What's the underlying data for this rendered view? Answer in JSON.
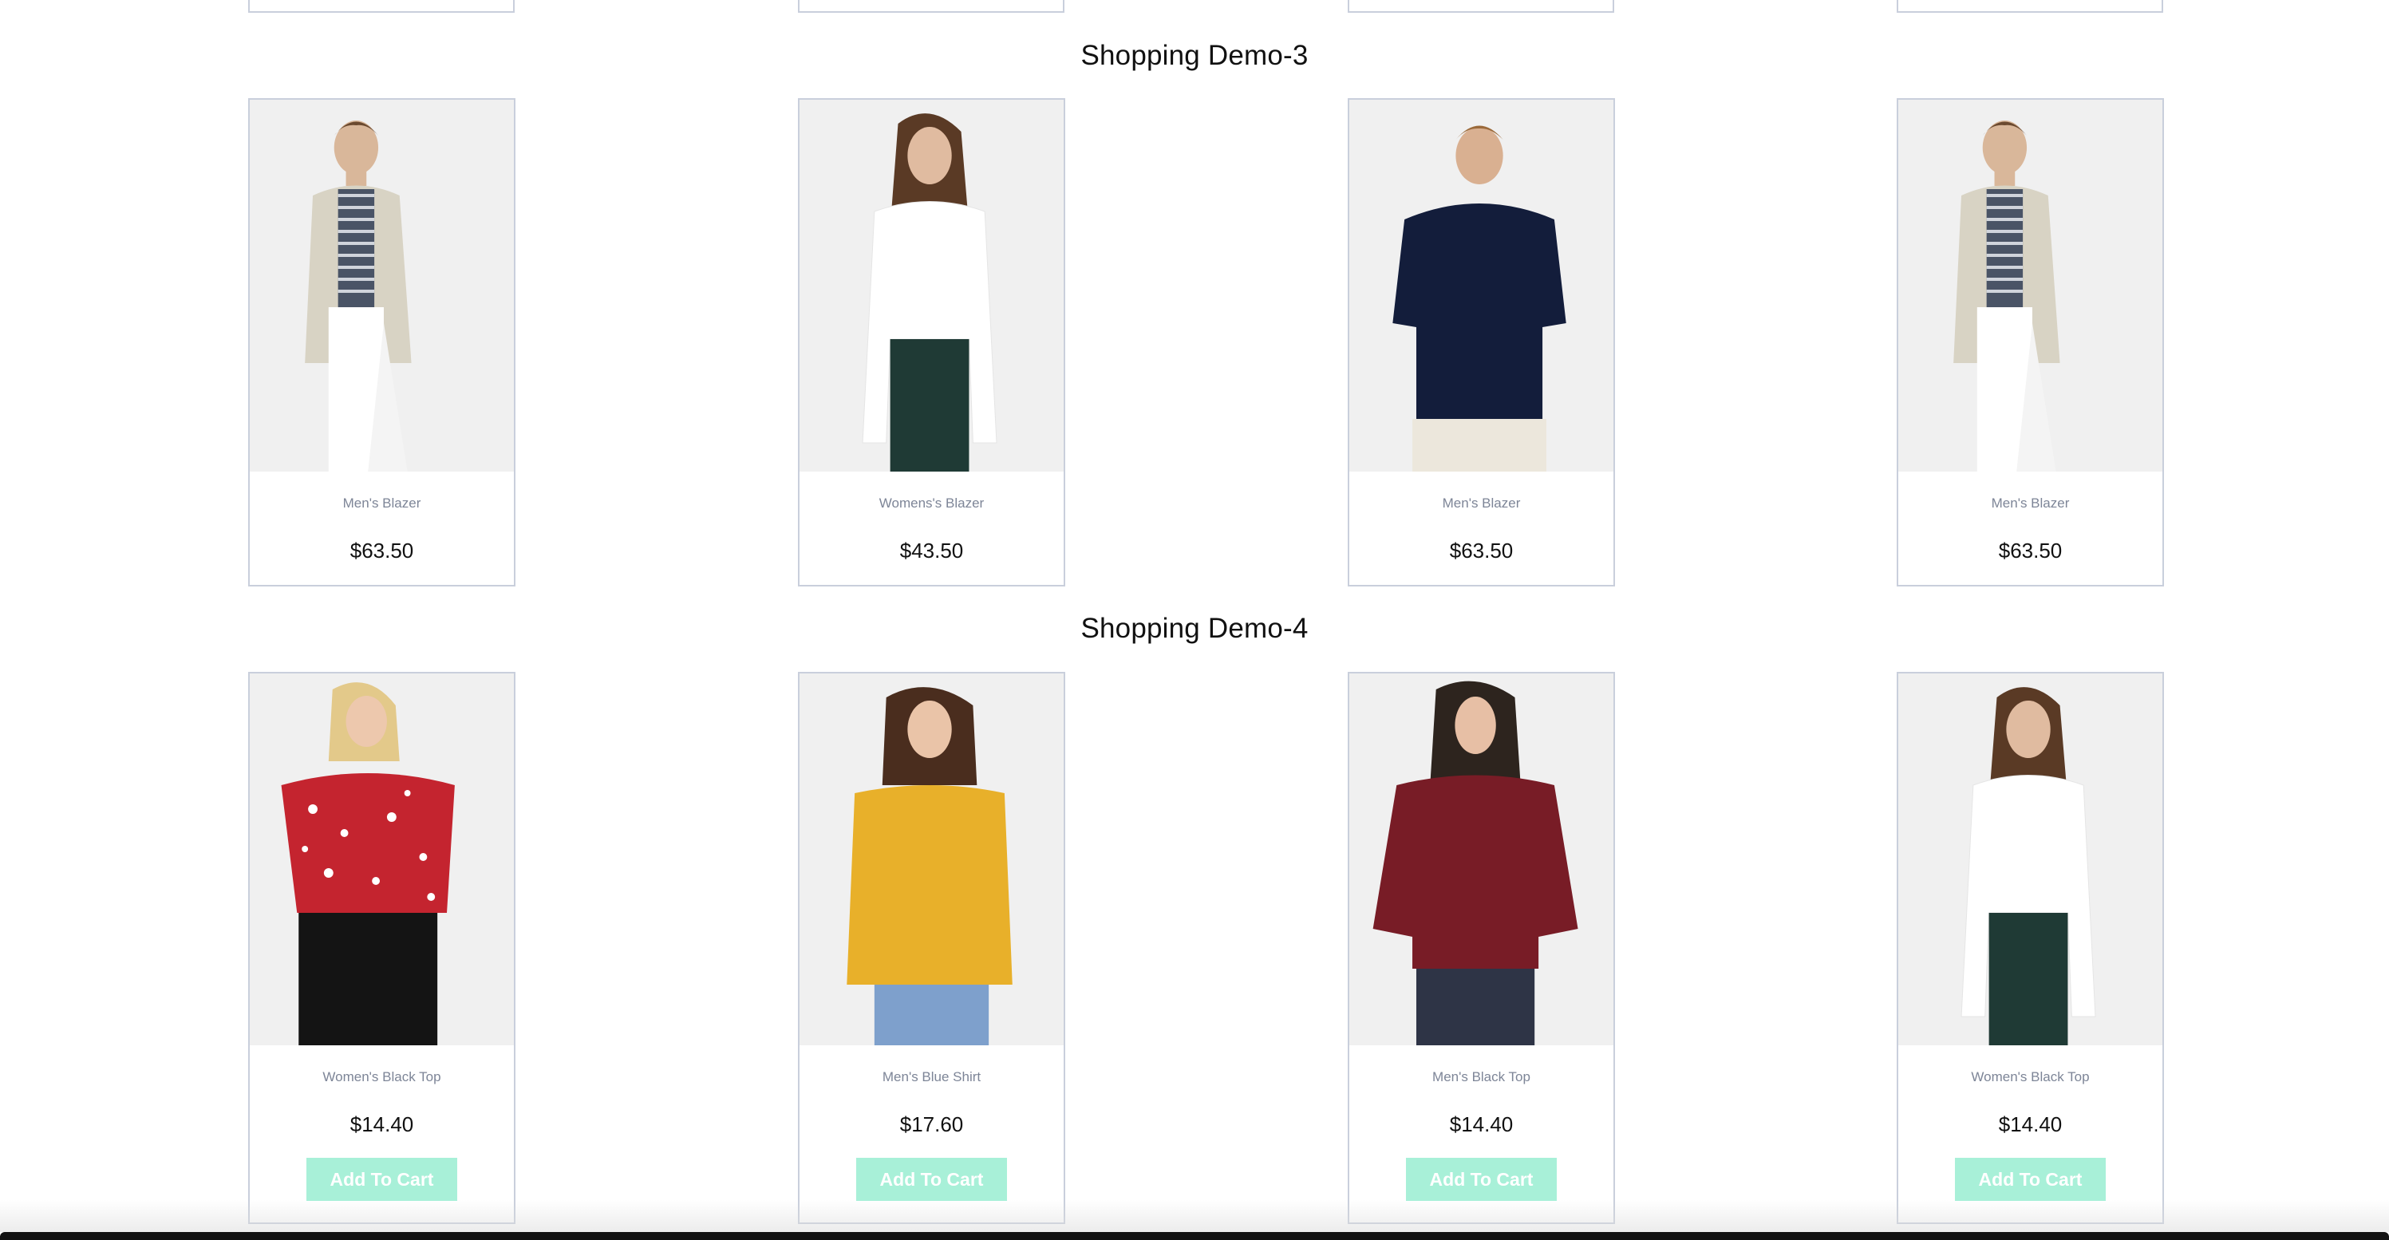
{
  "sections": [
    {
      "title": "Shopping Demo-3",
      "products": [
        {
          "name": "Men's Blazer",
          "price": "$63.50",
          "image": "man-blazer"
        },
        {
          "name": "Womens's Blazer",
          "price": "$43.50",
          "image": "woman-white-shirt"
        },
        {
          "name": "Men's Blazer",
          "price": "$63.50",
          "image": "man-polo"
        },
        {
          "name": "Men's Blazer",
          "price": "$63.50",
          "image": "man-blazer"
        }
      ]
    },
    {
      "title": "Shopping Demo-4",
      "button_label": "Add To Cart",
      "products": [
        {
          "name": "Women's Black Top",
          "price": "$14.40",
          "image": "woman-floral"
        },
        {
          "name": "Men's Blue Shirt",
          "price": "$17.60",
          "image": "woman-yellow"
        },
        {
          "name": "Men's Black Top",
          "price": "$14.40",
          "image": "woman-maroon"
        },
        {
          "name": "Women's Black Top",
          "price": "$14.40",
          "image": "woman-white-shirt"
        }
      ]
    }
  ],
  "colors": {
    "card_border": "#c9cfdc",
    "cart_button": "#a8f0d8",
    "name_text": "#7d8597"
  }
}
